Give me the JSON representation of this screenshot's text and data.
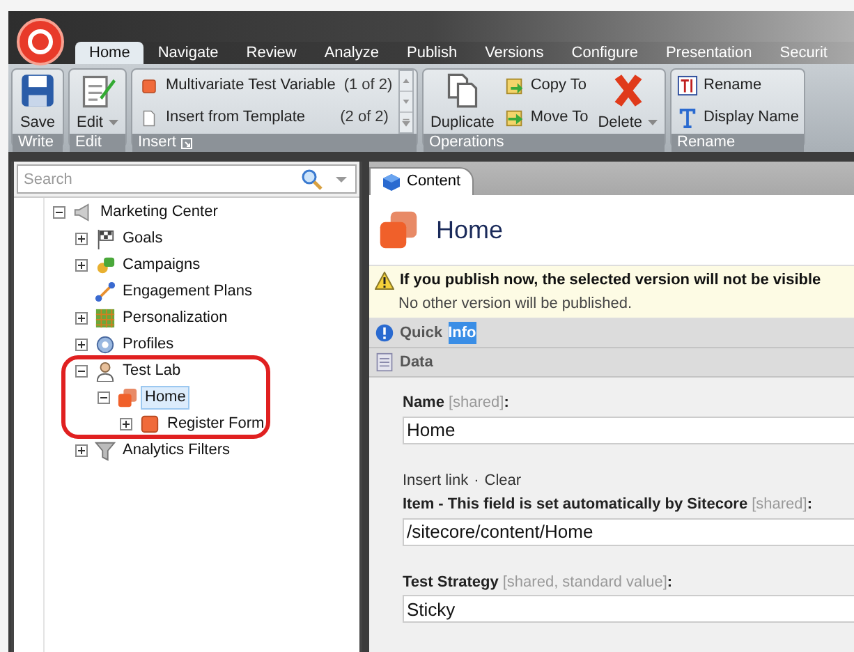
{
  "tabs": [
    {
      "label": "Home",
      "selected": true
    },
    {
      "label": "Navigate",
      "selected": false
    },
    {
      "label": "Review",
      "selected": false
    },
    {
      "label": "Analyze",
      "selected": false
    },
    {
      "label": "Publish",
      "selected": false
    },
    {
      "label": "Versions",
      "selected": false
    },
    {
      "label": "Configure",
      "selected": false
    },
    {
      "label": "Presentation",
      "selected": false
    },
    {
      "label": "Securit",
      "selected": false
    }
  ],
  "ribbon": [
    {
      "title": "Write",
      "items": [
        {
          "kind": "large",
          "label": "Save"
        }
      ]
    },
    {
      "title": "Edit",
      "items": [
        {
          "kind": "large",
          "label": "Edit",
          "dropdown": true
        }
      ]
    },
    {
      "title": "Insert",
      "launcher": true,
      "items": [
        {
          "kind": "gallery",
          "entries": [
            {
              "label": "Multivariate Test Variable",
              "count": "(1 of 2)"
            },
            {
              "label": "Insert from Template",
              "count": "(2 of 2)"
            }
          ]
        }
      ]
    },
    {
      "title": "Operations",
      "items": [
        {
          "kind": "large",
          "label": "Duplicate"
        },
        {
          "kind": "stack",
          "entries": [
            {
              "label": "Copy To"
            },
            {
              "label": "Move To"
            }
          ]
        },
        {
          "kind": "large",
          "label": "Delete",
          "dropdown": true
        }
      ]
    },
    {
      "title": "Rename",
      "items": [
        {
          "kind": "stack",
          "entries": [
            {
              "label": "Rename"
            },
            {
              "label": "Display Name"
            }
          ]
        }
      ]
    }
  ],
  "search": {
    "placeholder": "Search"
  },
  "tree": [
    {
      "label": "Marketing Center",
      "expanded": true,
      "selected": false,
      "children": [
        {
          "label": "Goals",
          "expanded": false,
          "selected": false
        },
        {
          "label": "Campaigns",
          "expanded": false,
          "selected": false
        },
        {
          "label": "Engagement Plans",
          "selected": false
        },
        {
          "label": "Personalization",
          "expanded": false,
          "selected": false
        },
        {
          "label": "Profiles",
          "expanded": false,
          "selected": false
        },
        {
          "label": "Test Lab",
          "expanded": true,
          "selected": false,
          "children": [
            {
              "label": "Home",
              "expanded": true,
              "selected": true,
              "children": [
                {
                  "label": "Register Form",
                  "expanded": false,
                  "selected": false
                }
              ]
            }
          ]
        },
        {
          "label": "Analytics Filters",
          "expanded": false,
          "selected": false
        }
      ]
    }
  ],
  "content_tabs": [
    {
      "label": "Content",
      "selected": true
    }
  ],
  "item": {
    "title": "Home"
  },
  "warning": {
    "title": "If you publish now, the selected version will not be visible",
    "text": "No other version will be published."
  },
  "sections": [
    {
      "label": "Quick",
      "highlighted": "Info"
    },
    {
      "label": "Data"
    }
  ],
  "fields": [
    {
      "label": "Name",
      "note": "[shared]",
      "suffix": ":",
      "value": "Home"
    },
    {
      "links": [
        "Insert link",
        "Clear"
      ],
      "separator": "·",
      "label": "Item - This field is set automatically by Sitecore",
      "note": "[shared]",
      "suffix": ":",
      "value": "/sitecore/content/Home"
    },
    {
      "label": "Test Strategy",
      "note": "[shared, standard value]",
      "suffix": ":",
      "value": "Sticky"
    }
  ]
}
